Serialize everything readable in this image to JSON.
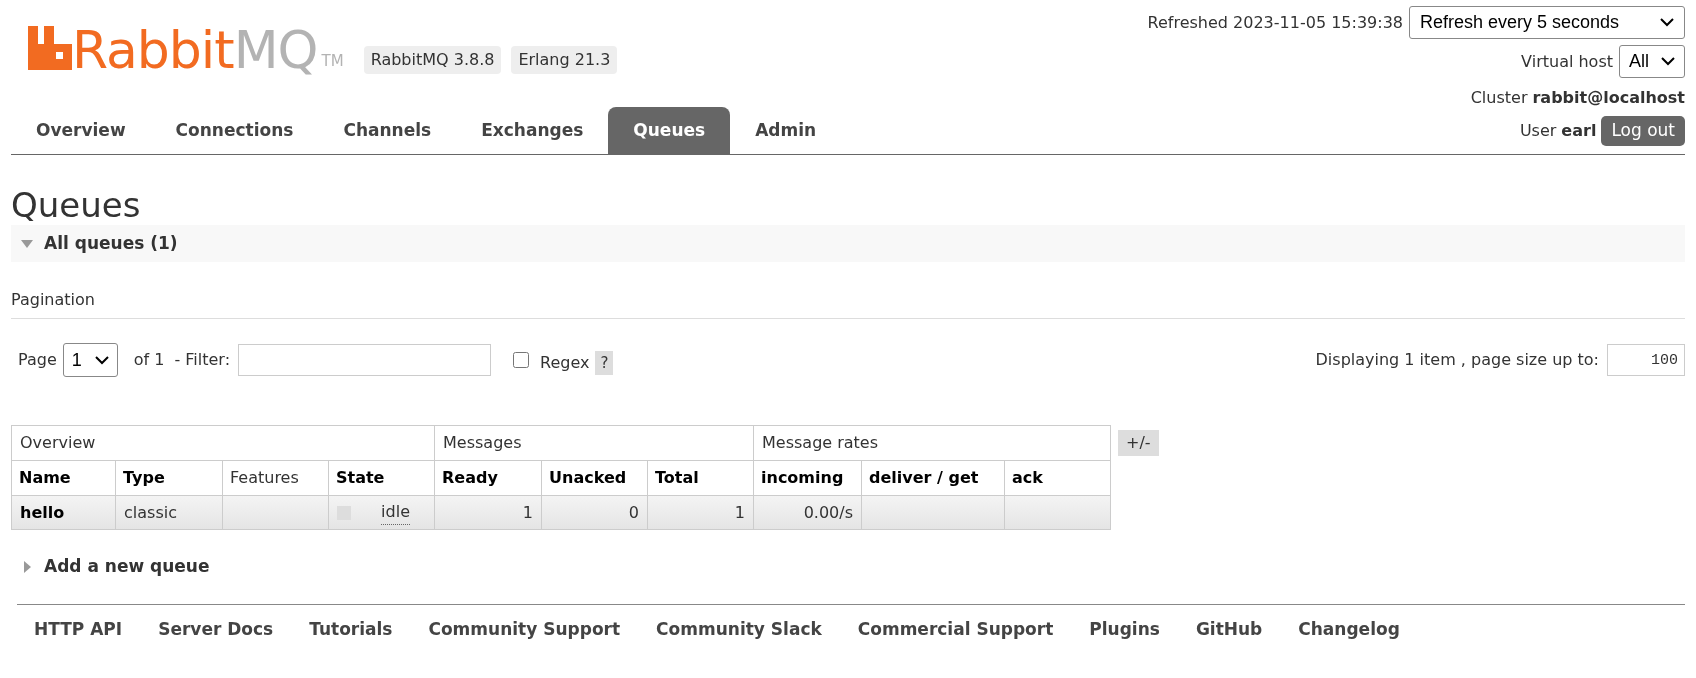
{
  "header": {
    "logo": {
      "primary": "Rabbit",
      "secondary": "MQ",
      "trademark": "TM"
    },
    "badges": [
      "RabbitMQ 3.8.8",
      "Erlang 21.3"
    ],
    "refreshed": "Refreshed 2023-11-05 15:39:38",
    "refresh_select": "Refresh every 5 seconds",
    "virtual_host": {
      "label": "Virtual host",
      "value": "All"
    },
    "cluster": {
      "label": "Cluster",
      "value": "rabbit@localhost"
    },
    "user": {
      "label": "User",
      "value": "earl"
    },
    "logout": "Log out"
  },
  "tabs": [
    {
      "label": "Overview",
      "selected": false
    },
    {
      "label": "Connections",
      "selected": false
    },
    {
      "label": "Channels",
      "selected": false
    },
    {
      "label": "Exchanges",
      "selected": false
    },
    {
      "label": "Queues",
      "selected": true
    },
    {
      "label": "Admin",
      "selected": false
    }
  ],
  "page_title": "Queues",
  "all_queues": {
    "label": "All queues (1)",
    "expanded": true
  },
  "pagination": {
    "title": "Pagination",
    "page_label": "Page",
    "page_value": "1",
    "of": "of 1",
    "filter_label": "- Filter:",
    "regex": {
      "label": "Regex",
      "checked": false
    },
    "help": "?",
    "displaying": "Displaying 1 item , page size up to:",
    "page_size": "100"
  },
  "table": {
    "groups": [
      {
        "label": "Overview"
      },
      {
        "label": "Messages"
      },
      {
        "label": "Message rates"
      }
    ],
    "columns": [
      {
        "label": "Name",
        "bold": true
      },
      {
        "label": "Type",
        "bold": true
      },
      {
        "label": "Features",
        "bold": false
      },
      {
        "label": "State",
        "bold": true
      },
      {
        "label": "Ready",
        "bold": true
      },
      {
        "label": "Unacked",
        "bold": true
      },
      {
        "label": "Total",
        "bold": true
      },
      {
        "label": "incoming",
        "bold": true
      },
      {
        "label": "deliver / get",
        "bold": true
      },
      {
        "label": "ack",
        "bold": true
      }
    ],
    "rows": [
      {
        "name": "hello",
        "type": "classic",
        "features": "",
        "state": "idle",
        "ready": "1",
        "unacked": "0",
        "total": "1",
        "incoming": "0.00/s",
        "deliver_get": "",
        "ack": ""
      }
    ],
    "toggle": "+/-"
  },
  "add_queue": {
    "label": "Add a new queue",
    "expanded": false
  },
  "footer": [
    "HTTP API",
    "Server Docs",
    "Tutorials",
    "Community Support",
    "Community Slack",
    "Commercial Support",
    "Plugins",
    "GitHub",
    "Changelog"
  ]
}
